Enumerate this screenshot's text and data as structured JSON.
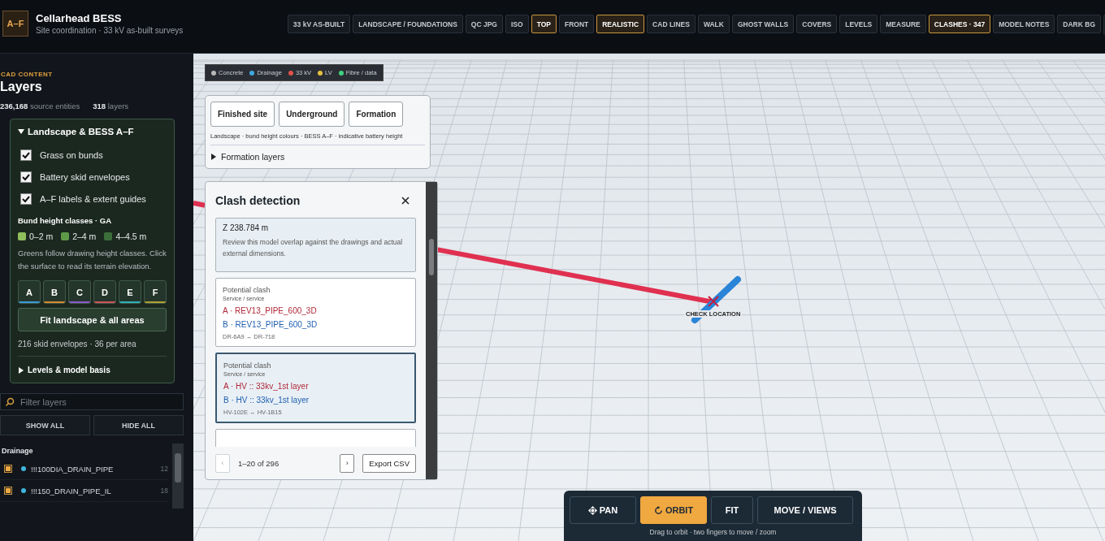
{
  "header": {
    "logo": "A–F",
    "title": "Cellarhead BESS",
    "subtitle": "Site coordination · 33 kV as-built surveys",
    "toolbar": [
      {
        "label": "33 kV AS-BUILT",
        "selected": false
      },
      {
        "label": "LANDSCAPE / FOUNDATIONS",
        "selected": false
      },
      {
        "label": "QC JPG",
        "selected": false
      },
      {
        "label": "ISO",
        "selected": false
      },
      {
        "label": "TOP",
        "selected": true
      },
      {
        "label": "FRONT",
        "selected": false
      },
      {
        "label": "REALISTIC",
        "selected": true
      },
      {
        "label": "CAD LINES",
        "selected": false
      },
      {
        "label": "WALK",
        "selected": false
      },
      {
        "label": "GHOST WALLS",
        "selected": false
      },
      {
        "label": "COVERS",
        "selected": false
      },
      {
        "label": "LEVELS",
        "selected": false
      },
      {
        "label": "MEASURE",
        "selected": false
      },
      {
        "label": "CLASHES · 347",
        "selected": true
      },
      {
        "label": "MODEL NOTES",
        "selected": false
      },
      {
        "label": "DARK BG",
        "selected": false
      }
    ]
  },
  "sidebar": {
    "eyebrow": "CAD CONTENT",
    "title": "Layers",
    "stats": [
      "**236,168** source entities",
      "**318** layers"
    ],
    "group": {
      "title": "Landscape & BESS A–F",
      "expanded": true,
      "checks": [
        {
          "label": "Grass on bunds",
          "checked": true
        },
        {
          "label": "Battery skid envelopes",
          "checked": true
        },
        {
          "label": "A–F labels & extent guides",
          "checked": true
        }
      ],
      "classes_title": "Bund height classes · GA",
      "classes": [
        {
          "label": "0–2 m",
          "color": "#8fc05c"
        },
        {
          "label": "2–4 m",
          "color": "#5f9a48"
        },
        {
          "label": "4–4.5 m",
          "color": "#3b6e3a"
        }
      ],
      "note": "Greens follow drawing height classes. Click the surface to read its terrain elevation.",
      "areas": [
        {
          "label": "A",
          "color": "#3a9ad8"
        },
        {
          "label": "B",
          "color": "#d8892e"
        },
        {
          "label": "C",
          "color": "#8a5ad0"
        },
        {
          "label": "D",
          "color": "#d0505a"
        },
        {
          "label": "E",
          "color": "#2fb0b8"
        },
        {
          "label": "F",
          "color": "#b0a030"
        }
      ],
      "fit_button": "Fit landscape & all areas",
      "summary": "216 skid envelopes · 36 per area",
      "subsection": {
        "label": "Levels & model basis",
        "expanded": false
      }
    },
    "filter": {
      "placeholder": "Filter layers"
    },
    "show_all": "SHOW ALL",
    "hide_all": "HIDE ALL",
    "layer_groups": [
      {
        "name": "Drainage",
        "layers": [
          {
            "name": "!!!100DIA_DRAIN_PIPE",
            "count": "12",
            "checked": true,
            "color": "#3fb6e0"
          },
          {
            "name": "!!!150_DRAIN_PIPE_IL",
            "count": "18",
            "checked": true,
            "color": "#3fb6e0"
          }
        ]
      }
    ]
  },
  "legend": [
    {
      "label": "Concrete",
      "color": "#b8b8b8"
    },
    {
      "label": "Drainage",
      "color": "#3fa8e0"
    },
    {
      "label": "33 kV",
      "color": "#e0524a"
    },
    {
      "label": "LV",
      "color": "#e8c040"
    },
    {
      "label": "Fibre / data",
      "color": "#40d080"
    }
  ],
  "view_panel": {
    "modes": [
      {
        "label": "Finished site",
        "selected": false
      },
      {
        "label": "Underground",
        "selected": false
      },
      {
        "label": "Formation",
        "selected": false
      }
    ],
    "caption": "Landscape · bund height colours · BESS A–F · indicative battery height",
    "formation": {
      "label": "Formation layers",
      "expanded": false
    }
  },
  "clash_panel": {
    "title": "Clash detection",
    "cards": [
      {
        "kind": "detail",
        "selected": false,
        "lines": [
          "Z 238.784 m"
        ],
        "note": "Review this model overlap against the drawings and actual external dimensions."
      },
      {
        "kind": "clash",
        "selected": false,
        "title": "Potential clash",
        "subtitle": "Service / service",
        "a": "A · REV13_PIPE_600_3D",
        "b": "B · REV13_PIPE_600_3D",
        "refs": "DR-6A9 ↔ DR-718"
      },
      {
        "kind": "clash",
        "selected": true,
        "title": "Potential clash",
        "subtitle": "Service / service",
        "a": "A · HV :: 33kv_1st layer",
        "b": "B · HV :: 33kv_1st layer",
        "refs": "HV-102E ↔ HV-1B15"
      },
      {
        "kind": "empty",
        "selected": false
      }
    ],
    "prev": {
      "label": "‹",
      "disabled": true
    },
    "range": "1–20 of 296",
    "next": {
      "label": "›",
      "disabled": false
    },
    "export": "Export CSV"
  },
  "marker": {
    "label": "CHECK LOCATION"
  },
  "controls": {
    "buttons": [
      {
        "label": "PAN",
        "kind": "move",
        "selected": false
      },
      {
        "label": "ORBIT",
        "kind": "orbit",
        "selected": true
      },
      {
        "label": "FIT",
        "kind": "plain",
        "selected": false
      },
      {
        "label": "MOVE / VIEWS",
        "kind": "plain",
        "selected": false
      }
    ],
    "hint": "Drag to orbit · two fingers to move / zoom"
  }
}
